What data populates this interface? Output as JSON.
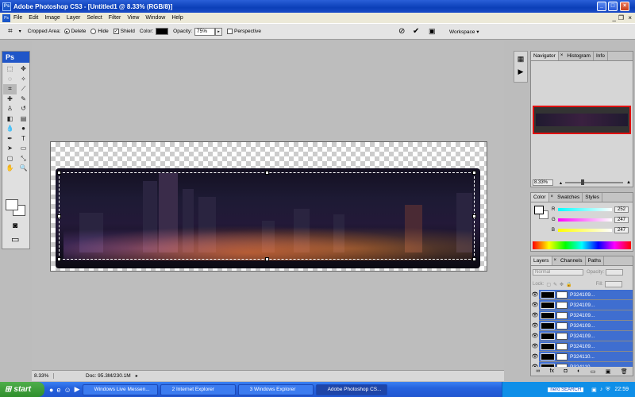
{
  "window": {
    "title": "Adobe Photoshop CS3 - [Untitled1 @ 8.33% (RGB/8)]",
    "app_badge": "Ps"
  },
  "menu": [
    "File",
    "Edit",
    "Image",
    "Layer",
    "Select",
    "Filter",
    "View",
    "Window",
    "Help"
  ],
  "options": {
    "cropped_area_label": "Cropped Area:",
    "delete_label": "Delete",
    "hide_label": "Hide",
    "shield_label": "Shield",
    "color_label": "Color:",
    "opacity_label": "Opacity:",
    "opacity_value": "75%",
    "perspective_label": "Perspective",
    "workspace_label": "Workspace",
    "shield_color": "#000000"
  },
  "toolbox": {
    "badge": "Ps"
  },
  "status": {
    "zoom": "8.33%",
    "doc": "Doc: 95.3M/230.1M"
  },
  "navigator": {
    "tabs": [
      "Navigator",
      "Histogram",
      "Info"
    ],
    "zoom": "8.33%"
  },
  "color_panel": {
    "tabs": [
      "Color",
      "Swatches",
      "Styles"
    ],
    "r_label": "R",
    "g_label": "G",
    "b_label": "B",
    "r": "252",
    "g": "247",
    "b": "247"
  },
  "layers_panel": {
    "tabs": [
      "Layers",
      "Channels",
      "Paths"
    ],
    "blend": "Normal",
    "opacity_label": "Opacity:",
    "lock_label": "Lock:",
    "fill_label": "Fill:",
    "layers": [
      "P324109...",
      "P324109...",
      "P324109...",
      "P324109...",
      "P324109...",
      "P324109...",
      "P324110...",
      "P324110..."
    ]
  },
  "taskbar": {
    "start": "start",
    "tasks": [
      "Windows Live Messen...",
      "2 Internet Explorer",
      "3 Windows Explorer",
      "Adobe Photoshop CS..."
    ],
    "tray_brand": "nero SEARCH",
    "clock": "22:59"
  }
}
